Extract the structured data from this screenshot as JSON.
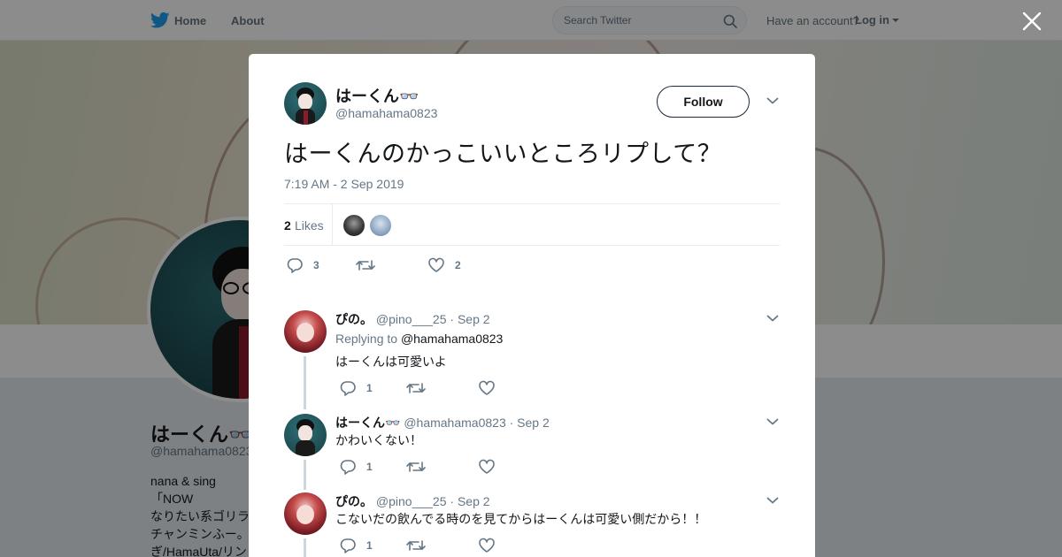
{
  "nav": {
    "home": "Home",
    "about": "About",
    "search_placeholder": "Search Twitter",
    "have_account": "Have an account?",
    "login": "Log in"
  },
  "profile": {
    "name": "はーくん👓",
    "handle": "@hamahama0823",
    "bio_lines": [
      "nana & sing「NOW",
      "なりたい系ゴリラ",
      "チャンミンふー。",
      "ぎ/HamaUta/リン"
    ]
  },
  "tweet": {
    "author_name": "はーくん👓",
    "author_handle": "@hamahama0823",
    "follow_label": "Follow",
    "text": "はーくんのかっこいいところリプして？",
    "timestamp": "7:19 AM - 2 Sep 2019",
    "likes_count": "2",
    "likes_label": "Likes",
    "reply_count": "3",
    "retweet_count": "",
    "like_count": "2"
  },
  "replies": [
    {
      "name": "ぴの。",
      "handle": "@pino___25",
      "date": "· Sep 2",
      "replying_label": "Replying to",
      "replying_to": "@hamahama0823",
      "text": "はーくんは可愛いよ",
      "reply_count": "1",
      "like_count": ""
    },
    {
      "name": "はーくん👓",
      "handle": "@hamahama0823",
      "date": "· Sep 2",
      "text": "かわいくない！",
      "reply_count": "1",
      "like_count": ""
    },
    {
      "name": "ぴの。",
      "handle": "@pino___25",
      "date": "· Sep 2",
      "text": "こないだの飲んでる時のを見てからはーくんは可愛い側だから！！",
      "reply_count": "1",
      "like_count": ""
    }
  ],
  "colors": {
    "twitter_blue": "#1da1f2",
    "secondary_text": "#657786",
    "overlay": "rgba(0,0,0,0.45)"
  },
  "icons": [
    "twitter-bird-icon",
    "search-icon",
    "close-icon",
    "chevron-down-icon",
    "reply-icon",
    "retweet-icon",
    "like-icon"
  ]
}
